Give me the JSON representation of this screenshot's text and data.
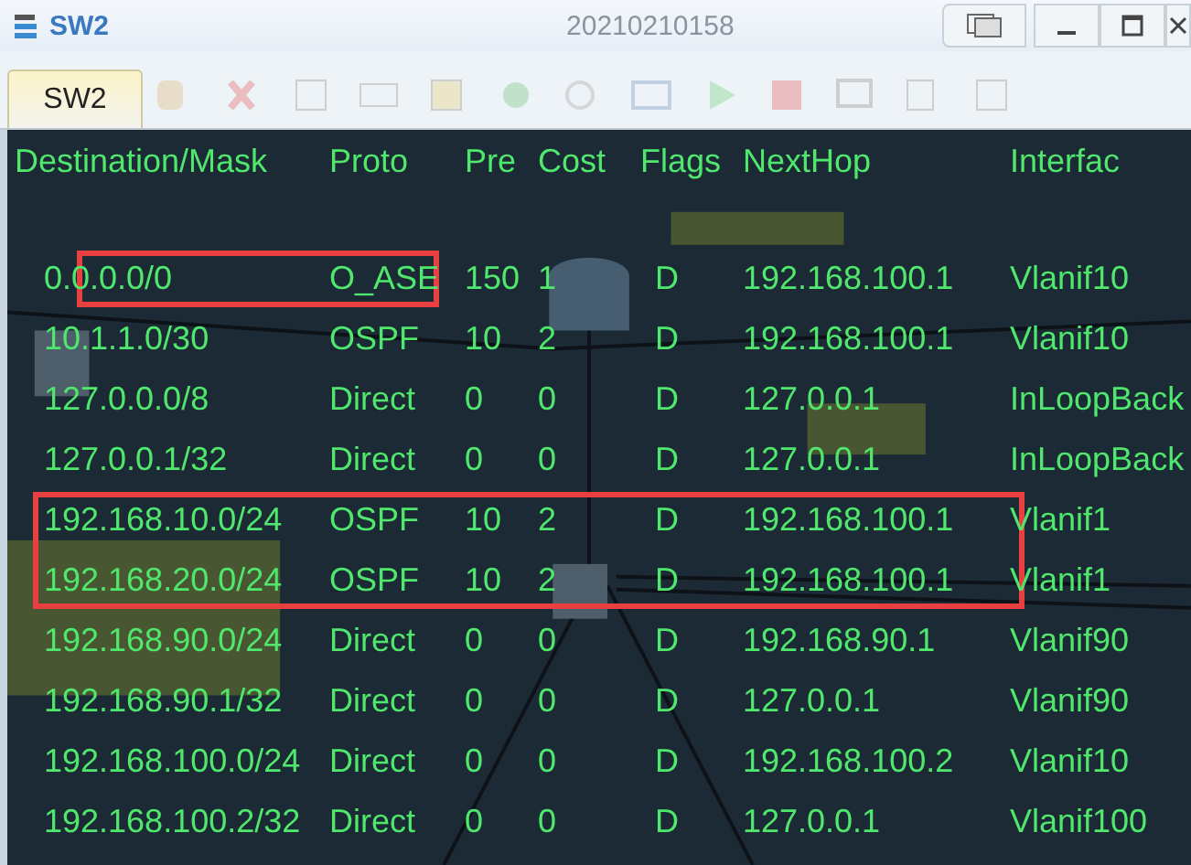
{
  "window": {
    "title": "SW2",
    "subtitle": "20210210158"
  },
  "tabs": [
    {
      "label": "SW2",
      "selected": true
    }
  ],
  "table": {
    "columns": [
      "Destination/Mask",
      "Proto",
      "Pre",
      "Cost",
      "Flags",
      "NextHop",
      "Interfac"
    ],
    "rows": [
      {
        "cells": [
          "0.0.0.0/0",
          "O_ASE",
          "150",
          "1",
          "D",
          "192.168.100.1",
          "Vlanif10"
        ],
        "prefix_boxed": true,
        "row_boxed": false
      },
      {
        "cells": [
          "10.1.1.0/30",
          "OSPF",
          "10",
          "2",
          "D",
          "192.168.100.1",
          "Vlanif10"
        ],
        "prefix_boxed": false,
        "row_boxed": false
      },
      {
        "cells": [
          "127.0.0.0/8",
          "Direct",
          "0",
          "0",
          "D",
          "127.0.0.1",
          "InLoopBack"
        ],
        "prefix_boxed": false,
        "row_boxed": false
      },
      {
        "cells": [
          "127.0.0.1/32",
          "Direct",
          "0",
          "0",
          "D",
          "127.0.0.1",
          "InLoopBack"
        ],
        "prefix_boxed": false,
        "row_boxed": false
      },
      {
        "cells": [
          "192.168.10.0/24",
          "OSPF",
          "10",
          "2",
          "D",
          "192.168.100.1",
          "Vlanif1"
        ],
        "prefix_boxed": false,
        "row_boxed": true
      },
      {
        "cells": [
          "192.168.20.0/24",
          "OSPF",
          "10",
          "2",
          "D",
          "192.168.100.1",
          "Vlanif1"
        ],
        "prefix_boxed": false,
        "row_boxed": true
      },
      {
        "cells": [
          "192.168.90.0/24",
          "Direct",
          "0",
          "0",
          "D",
          "192.168.90.1",
          "Vlanif90"
        ],
        "prefix_boxed": false,
        "row_boxed": false
      },
      {
        "cells": [
          "192.168.90.1/32",
          "Direct",
          "0",
          "0",
          "D",
          "127.0.0.1",
          "Vlanif90"
        ],
        "prefix_boxed": false,
        "row_boxed": false
      },
      {
        "cells": [
          "192.168.100.0/24",
          "Direct",
          "0",
          "0",
          "D",
          "192.168.100.2",
          "Vlanif10"
        ],
        "prefix_boxed": false,
        "row_boxed": false
      },
      {
        "cells": [
          "192.168.100.2/32",
          "Direct",
          "0",
          "0",
          "D",
          "127.0.0.1",
          "Vlanif100"
        ],
        "prefix_boxed": false,
        "row_boxed": false
      }
    ]
  }
}
